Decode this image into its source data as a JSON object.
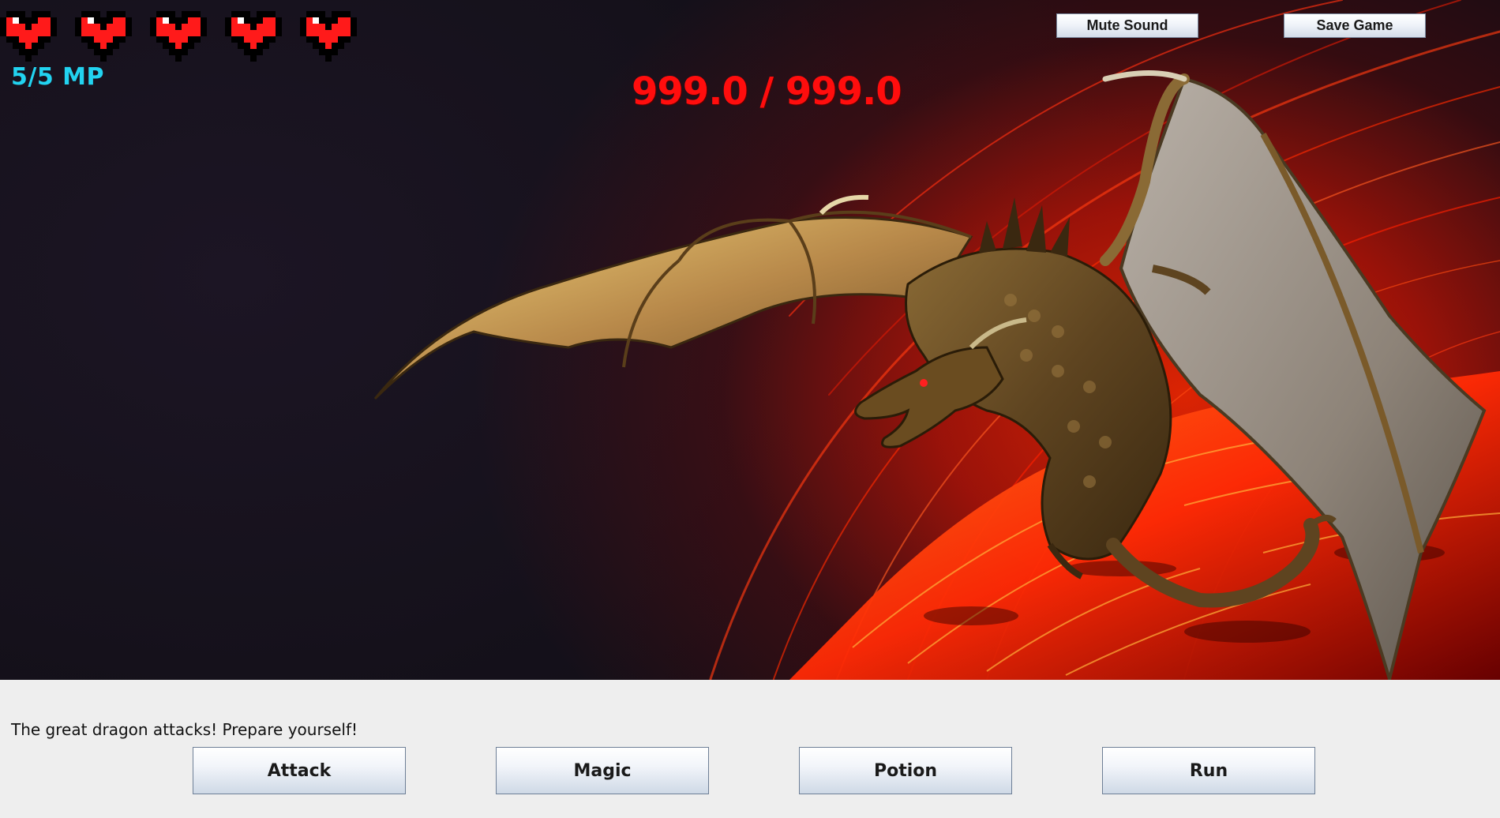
{
  "hud": {
    "hearts": [
      "heart-full",
      "heart-full",
      "heart-full",
      "heart-full",
      "heart-full"
    ],
    "mp_text": "5/5 MP",
    "boss_hp_text": "999.0 / 999.0"
  },
  "toolbar": {
    "mute_label": "Mute Sound",
    "save_label": "Save Game"
  },
  "battle": {
    "message": "The great dragon attacks! Prepare yourself!"
  },
  "actions": {
    "attack_label": "Attack",
    "magic_label": "Magic",
    "potion_label": "Potion",
    "run_label": "Run"
  },
  "colors": {
    "heart": "#ff1a1a",
    "mp": "#22d3f0",
    "boss_hp": "#ff0d0d",
    "panel": "#eeeeee"
  }
}
